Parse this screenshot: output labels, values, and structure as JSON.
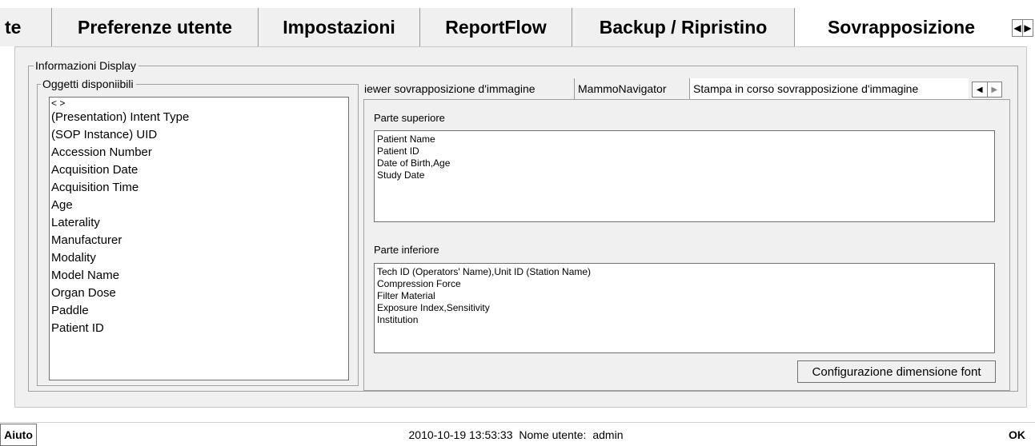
{
  "top_tabs": [
    {
      "label": "te"
    },
    {
      "label": "Preferenze utente"
    },
    {
      "label": "Impostazioni"
    },
    {
      "label": "ReportFlow"
    },
    {
      "label": "Backup / Ripristino"
    },
    {
      "label": "Sovrapposizione",
      "selected": true
    }
  ],
  "top_nav": {
    "prev_icon": "triangle-left",
    "next_icon": "triangle-right"
  },
  "display_info": {
    "legend": "Informazioni Display",
    "available_objects": {
      "legend": "Oggetti disponiibili",
      "items": [
        "< >",
        "(Presentation) Intent Type",
        "(SOP Instance) UID",
        "Accession Number",
        "Acquisition Date",
        "Acquisition Time",
        "Age",
        "Laterality",
        "Manufacturer",
        "Modality",
        "Model Name",
        "Organ Dose",
        "Paddle",
        "Patient ID"
      ]
    }
  },
  "inner_tabs": [
    {
      "label": "iewer sovrapposizione d'immagine"
    },
    {
      "label": "MammoNavigator"
    },
    {
      "label": "Stampa in corso sovrapposizione d'immagine",
      "selected": true
    }
  ],
  "top_section": {
    "label": "Parte superiore",
    "lines": [
      "Patient Name",
      "Patient ID",
      "Date of Birth,Age",
      "Study Date"
    ]
  },
  "bottom_section": {
    "label": "Parte inferiore",
    "lines": [
      "Tech ID (Operators' Name),Unit ID (Station Name)",
      "Compression Force",
      "Filter Material",
      "Exposure Index,Sensitivity",
      "Institution"
    ]
  },
  "font_button": "Configurazione dimensione font",
  "status": {
    "help_button": "Aiuto",
    "datetime": "2010-10-19  13:53:33",
    "user_label": "Nome utente:",
    "user": "admin",
    "ok_button": "OK"
  }
}
